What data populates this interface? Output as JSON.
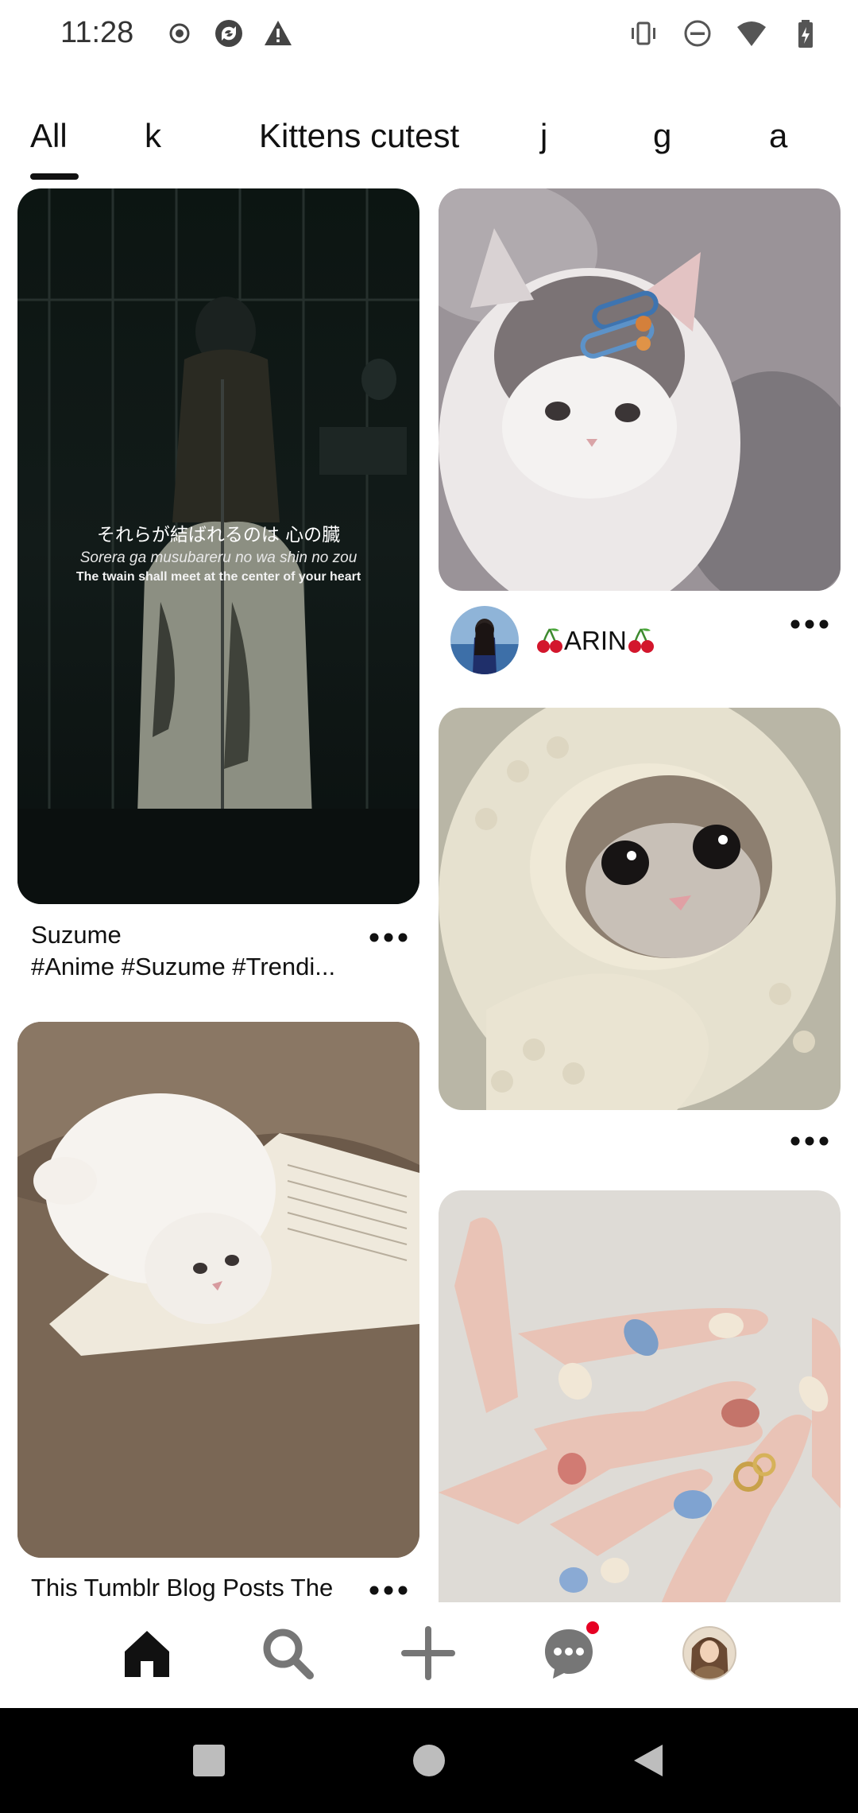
{
  "status_bar": {
    "time": "11:28",
    "left_icons": [
      "record-icon",
      "sync-icon",
      "alert-icon"
    ],
    "right_icons": [
      "vibrate-icon",
      "do-not-disturb-icon",
      "wifi-icon",
      "battery-icon"
    ]
  },
  "tabs": [
    {
      "label": "All",
      "active": true
    },
    {
      "label": "k",
      "active": false
    },
    {
      "label": "Kittens cutest",
      "active": false
    },
    {
      "label": "j",
      "active": false
    },
    {
      "label": "g",
      "active": false
    },
    {
      "label": "a",
      "active": false
    }
  ],
  "pins": {
    "suzume": {
      "caption_jp": "それらが結ばれるのは 心の臓",
      "caption_romaji": "Sorera ga musubareru no wa shin no zou",
      "caption_en": "The twain shall meet at the center of your heart",
      "title_line1": "Suzume",
      "title_line2": "#Anime #Suzume #Trendi..."
    },
    "kitten_hairclip": {
      "creator": "ARIN"
    },
    "kitten_blanket": {},
    "white_cat_book": {
      "title": "This Tumblr Blog Posts The"
    },
    "nails": {}
  },
  "bottom_nav": {
    "items": [
      "home-icon",
      "search-icon",
      "create-icon",
      "messages-icon",
      "profile-avatar"
    ]
  },
  "colors": {
    "accent": "#e60023",
    "text": "#111111",
    "background": "#ffffff"
  }
}
